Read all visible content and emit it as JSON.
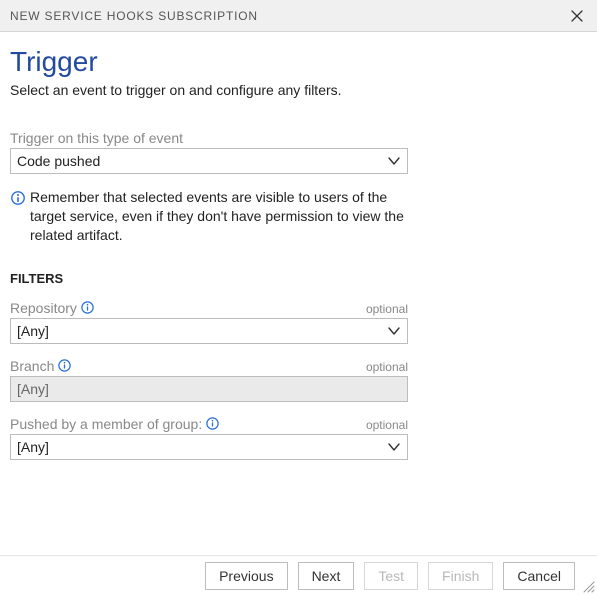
{
  "titlebar": {
    "title": "NEW SERVICE HOOKS SUBSCRIPTION"
  },
  "page": {
    "heading": "Trigger",
    "description": "Select an event to trigger on and configure any filters."
  },
  "event_field": {
    "label": "Trigger on this type of event",
    "value": "Code pushed"
  },
  "info_note": "Remember that selected events are visible to users of the target service, even if they don't have permission to view the related artifact.",
  "filters": {
    "heading": "FILTERS",
    "repository": {
      "label": "Repository",
      "optional": "optional",
      "value": "[Any]"
    },
    "branch": {
      "label": "Branch",
      "optional": "optional",
      "value": "[Any]"
    },
    "pushed_by": {
      "label": "Pushed by a member of group:",
      "optional": "optional",
      "value": "[Any]"
    }
  },
  "footer": {
    "previous": "Previous",
    "next": "Next",
    "test": "Test",
    "finish": "Finish",
    "cancel": "Cancel"
  }
}
